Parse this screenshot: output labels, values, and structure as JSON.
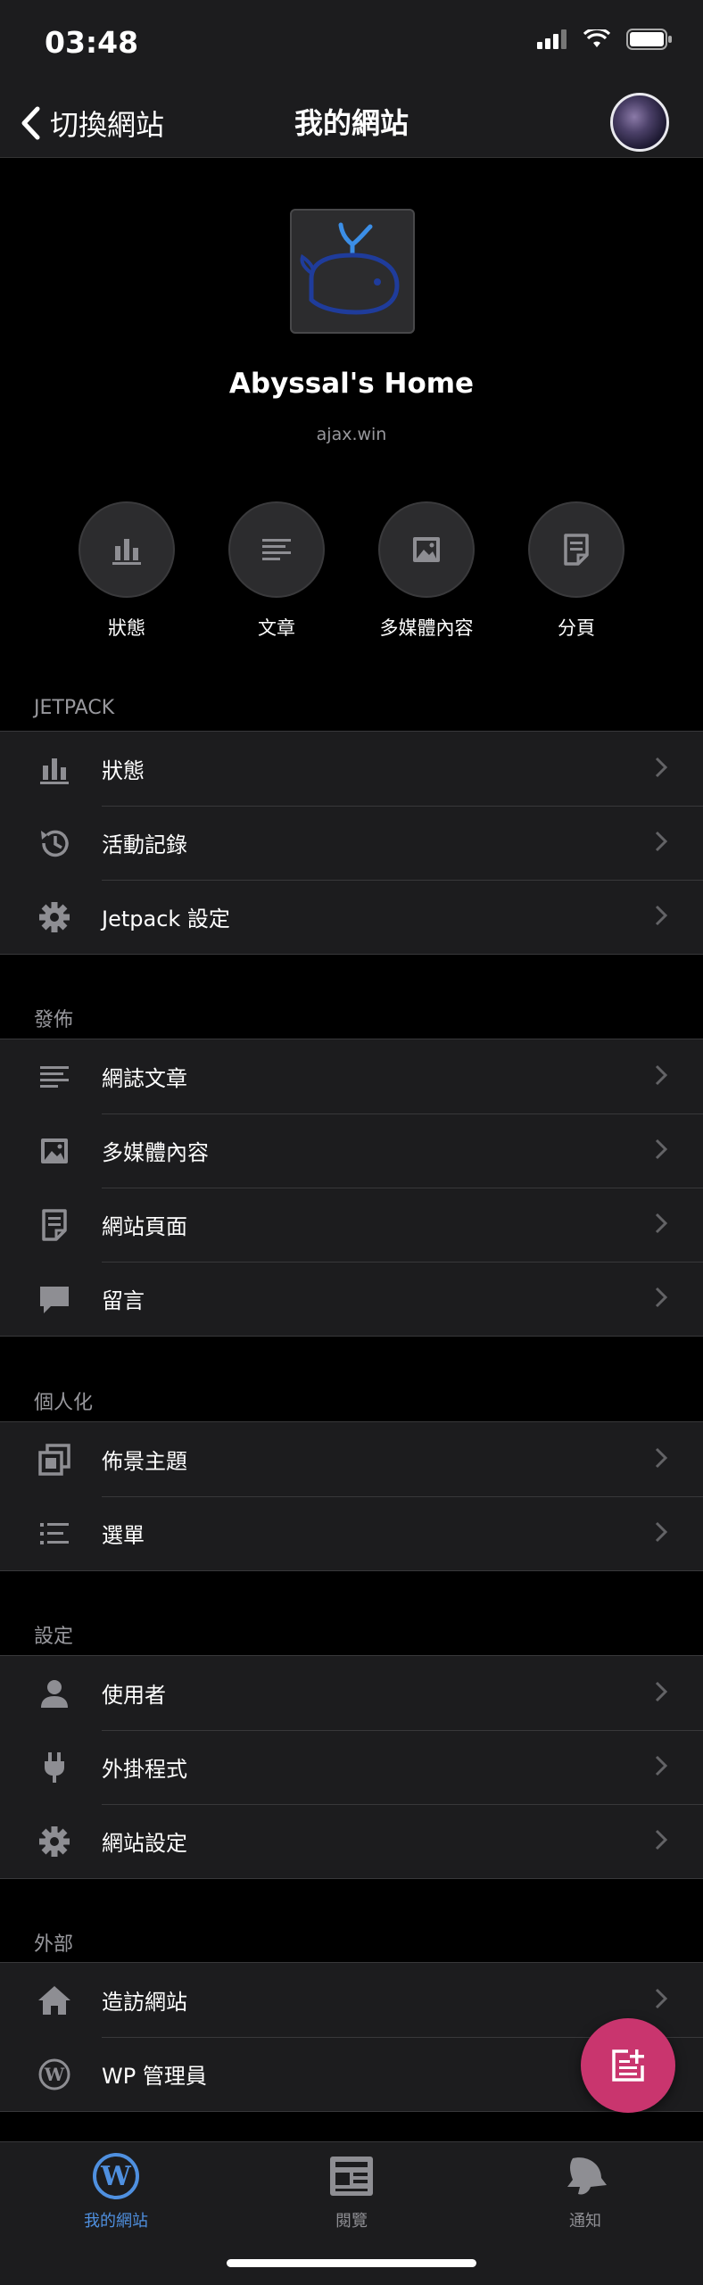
{
  "status_bar": {
    "time": "03:48"
  },
  "nav": {
    "back_label": "切換網站",
    "title": "我的網站"
  },
  "site": {
    "name": "Abyssal's Home",
    "url": "ajax.win"
  },
  "quick_actions": [
    {
      "label": "狀態",
      "icon": "stats-icon"
    },
    {
      "label": "文章",
      "icon": "posts-icon"
    },
    {
      "label": "多媒體內容",
      "icon": "media-icon"
    },
    {
      "label": "分頁",
      "icon": "pages-icon"
    }
  ],
  "sections": {
    "jetpack": {
      "header": "JETPACK",
      "items": [
        "狀態",
        "活動記錄",
        "Jetpack 設定"
      ]
    },
    "publish": {
      "header": "發佈",
      "items": [
        "網誌文章",
        "多媒體內容",
        "網站頁面",
        "留言"
      ]
    },
    "personalize": {
      "header": "個人化",
      "items": [
        "佈景主題",
        "選單"
      ]
    },
    "settings": {
      "header": "設定",
      "items": [
        "使用者",
        "外掛程式",
        "網站設定"
      ]
    },
    "external": {
      "header": "外部",
      "items": [
        "造訪網站",
        "WP 管理員"
      ]
    }
  },
  "tab_bar": [
    {
      "label": "我的網站",
      "active": true,
      "icon": "wordpress-icon"
    },
    {
      "label": "閱覽",
      "active": false,
      "icon": "reader-icon"
    },
    {
      "label": "通知",
      "active": false,
      "icon": "notifications-icon"
    }
  ],
  "colors": {
    "accent_blue": "#4f90e0",
    "fab_pink": "#c9356e",
    "icon_gray": "#8e8e93"
  }
}
